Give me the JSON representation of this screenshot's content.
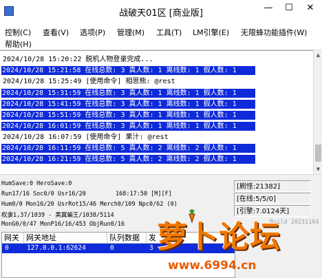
{
  "window": {
    "title": "战破天01区 [商业版]",
    "minimize_glyph": "—",
    "maximize_glyph": "☐",
    "close_glyph": "✕"
  },
  "menu": [
    {
      "label": "控制(C)"
    },
    {
      "label": "查看(V)"
    },
    {
      "label": "选项(P)"
    },
    {
      "label": "管理(M)"
    },
    {
      "label": "工具(T)"
    },
    {
      "label": "LM引擎(E)"
    },
    {
      "label": "无限蜂功能插件(W)"
    },
    {
      "label": "帮助(H)"
    }
  ],
  "log": [
    {
      "text": "2024/10/28 15:20:22 脱机人物登录完成...",
      "highlight": false
    },
    {
      "text": "2024/10/28 15:21:58 在线总数: 3 真人数: 1 离线数: 1 假人数: 1",
      "highlight": true
    },
    {
      "text": "2024/10/28 15:25:49 [使用命令] 相思熊: @rest",
      "highlight": false
    },
    {
      "text": "2024/10/28 15:31:59 在线总数: 3 真人数: 1 离线数: 1 假人数: 1",
      "highlight": true
    },
    {
      "text": "2024/10/28 15:41:59 在线总数: 3 真人数: 1 离线数: 1 假人数: 1",
      "highlight": true
    },
    {
      "text": "2024/10/28 15:51:59 在线总数: 3 真人数: 1 离线数: 1 假人数: 1",
      "highlight": true
    },
    {
      "text": "2024/10/28 16:01:59 在线总数: 3 真人数: 1 离线数: 1 假人数: 1",
      "highlight": true
    },
    {
      "text": "2024/10/28 16:07:59 [使用命令] 果汁: @rest",
      "highlight": false
    },
    {
      "text": "2024/10/28 16:11:59 在线总数: 5 真人数: 2 离线数: 2 假人数: 1",
      "highlight": true
    },
    {
      "text": "2024/10/28 16:21:59 在线总数: 5 真人数: 2 离线数: 2 假人数: 1",
      "highlight": true
    }
  ],
  "scrollbar": {
    "up_glyph": "▲",
    "down_glyph": "▼"
  },
  "status": {
    "line1": "HumSave:0 HeroSave:0",
    "line2": "Run17/16 Soc0/0 Usr16/20",
    "clock": "168:17:50 [M][F]",
    "line3": "Hum0/0 Mon16/20 UsrRot15/46 Merch0/109 Npc0/62 (0)",
    "line4": "权隶1,37/1039 - 黑翼蝙王/1038/5114",
    "line5": "MonG0/0/47 MonP16/16/453 ObjRun0/16",
    "box_refresh": "[刷怪:21382]",
    "box_online": "[在线:5/5/0]",
    "box_engine": "[引擎:7.0124天]",
    "build": "Build 20231104"
  },
  "gateway_table": {
    "headers": [
      "网关",
      "网关地址",
      "队列数据",
      "发"
    ],
    "rows": [
      [
        "0",
        "127.0.0.1:62624",
        "0",
        "3"
      ]
    ]
  },
  "watermark": {
    "title": "萝卜论坛",
    "url": "www.6994.cn"
  },
  "colors": {
    "highlight": "#0f2bd9",
    "watermark": "#f07800"
  }
}
